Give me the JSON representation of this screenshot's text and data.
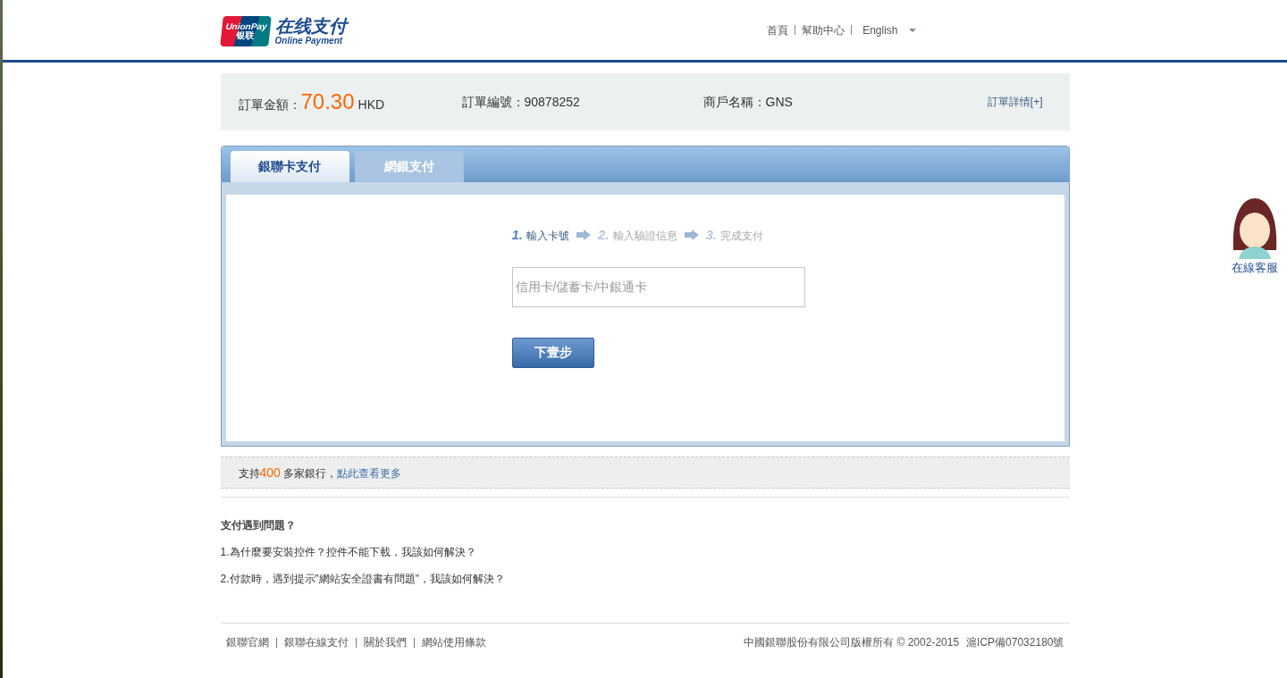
{
  "header": {
    "logo": {
      "brand": "UnionPay",
      "brand_cn": "银联",
      "title": "在线支付",
      "subtitle": "Online Payment"
    },
    "nav": [
      "首頁",
      "幫助中心"
    ],
    "language": {
      "value": "English"
    }
  },
  "order": {
    "amount_label": "訂單金額：",
    "amount": "70.30",
    "currency": "HKD",
    "number_label": "訂單編號：",
    "number": "90878252",
    "merchant_label": "商戶名稱：",
    "merchant": "GNS",
    "details_link": "訂單詳情[+]"
  },
  "tabs": [
    {
      "label": "銀聯卡支付",
      "selected": true
    },
    {
      "label": "網銀支付",
      "selected": false
    }
  ],
  "steps": [
    {
      "number": "1.",
      "label": "輸入卡號",
      "selected": true
    },
    {
      "number": "2.",
      "label": "輸入驗證信息",
      "selected": false
    },
    {
      "number": "3.",
      "label": "完成支付",
      "selected": false
    }
  ],
  "card_field": {
    "placeholder": "信用卡/儲蓄卡/中銀通卡"
  },
  "next_button": "下壹步",
  "banks": {
    "prefix": "支持",
    "count": "400",
    "suffix": " 多家銀行，",
    "link": "點此查看更多"
  },
  "help": {
    "title": "支付遇到問題？",
    "items": [
      "1.為什麼要安裝控件？控件不能下載，我該如何解決？",
      "2.付款時，遇到提示\"網站安全證書有問題\"，我該如何解決？"
    ]
  },
  "footer": {
    "links": [
      "銀聯官網",
      "銀聯在線支付",
      "關於我們",
      "網站使用條款"
    ],
    "copyright": "中國銀聯股份有限公司版權所有 © 2002-2015",
    "icp": "滬ICP備07032180號"
  },
  "support": {
    "label": "在線客服"
  }
}
